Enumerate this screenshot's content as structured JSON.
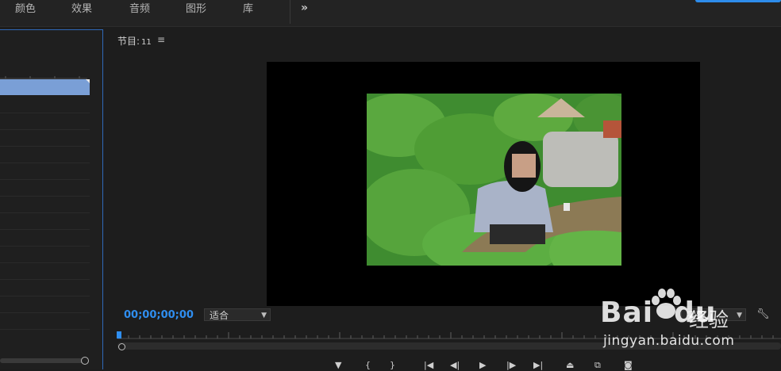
{
  "workspace_tabs": [
    "颜色",
    "效果",
    "音频",
    "图形",
    "库"
  ],
  "more_label": "»",
  "program_monitor": {
    "title": "节目:",
    "sequence": "11",
    "menu_icon": "hamburger-menu-icon"
  },
  "timecode": "00;00;00;00",
  "fit_select": {
    "value": "适合"
  },
  "resolution_select": {
    "value": "完整"
  },
  "watermark": {
    "logo_text": "Bai",
    "logo_text_2": "du",
    "cn_text": "经验",
    "url": "jingyan.baidu.com"
  },
  "transport_icons": [
    "add-marker-icon",
    "mark-in-icon",
    "mark-out-icon",
    "go-to-in-icon",
    "step-back-icon",
    "play-icon",
    "step-forward-icon",
    "go-to-out-icon",
    "lift-icon",
    "extract-icon",
    "export-frame-icon"
  ],
  "colors": {
    "accent": "#2f8ef0",
    "panel_border": "#2f69b8",
    "selection_bar": "#7a9fd6"
  }
}
